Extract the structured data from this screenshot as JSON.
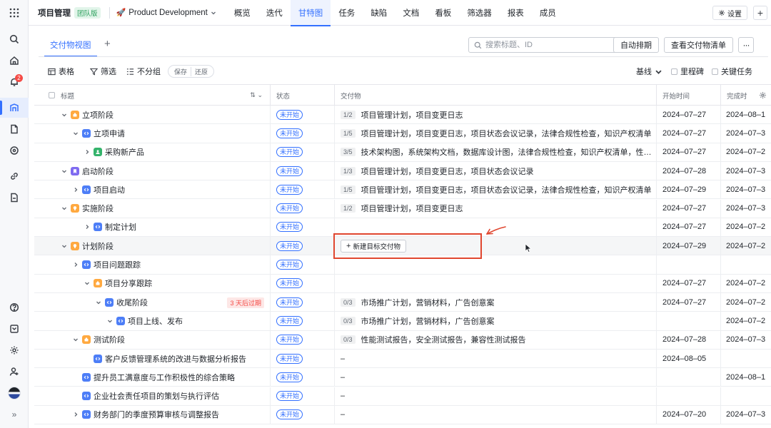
{
  "header": {
    "title": "项目管理",
    "edition": "团队版",
    "project_emoji": "🚀",
    "project_name": "Product Development",
    "tabs": [
      "概览",
      "迭代",
      "甘特图",
      "任务",
      "缺陷",
      "文档",
      "看板",
      "筛选器",
      "报表",
      "成员"
    ],
    "active_tab": "甘特图",
    "settings_label": "设置"
  },
  "view": {
    "tab_label": "交付物视图",
    "search_placeholder": "搜索标题、ID",
    "auto_schedule_label": "自动排期",
    "view_list_label": "查看交付物清单"
  },
  "toolbar": {
    "table_label": "表格",
    "filter_label": "筛选",
    "group_label": "不分组",
    "save_label": "保存",
    "restore_label": "还原",
    "baseline_label": "基线",
    "milestone_label": "里程碑",
    "critical_label": "关键任务"
  },
  "table": {
    "columns": {
      "title": "标题",
      "status": "状态",
      "deliverables": "交付物",
      "start": "开始时间",
      "end": "完成时"
    },
    "new_deliverable_label": "新建目标交付物",
    "rows": [
      {
        "title": "立项阶段",
        "status": "未开始",
        "progress": "1/2",
        "deliverables": "项目管理计划，项目变更日志",
        "start": "2024–07–27",
        "end": "2024–08–1"
      },
      {
        "title": "立项申请",
        "status": "未开始",
        "progress": "1/5",
        "deliverables": "项目管理计划，项目变更日志，项目状态会议记录，法律合规性检查，知识产权清单",
        "start": "2024–07–27",
        "end": "2024–07–3"
      },
      {
        "title": "采购新产品",
        "status": "未开始",
        "progress": "3/5",
        "deliverables": "技术架构图，系统架构文档，数据库设计图，法律合规性检查，知识产权清单，性能...",
        "start": "2024–07–27",
        "end": "2024–07–2"
      },
      {
        "title": "启动阶段",
        "status": "未开始",
        "progress": "1/3",
        "deliverables": "项目管理计划，项目变更日志，项目状态会议记录",
        "start": "2024–07–28",
        "end": "2024–07–3"
      },
      {
        "title": "项目启动",
        "status": "未开始",
        "progress": "1/5",
        "deliverables": "项目管理计划，项目变更日志，项目状态会议记录，法律合规性检查，知识产权清单",
        "start": "2024–07–29",
        "end": "2024–07–3"
      },
      {
        "title": "实施阶段",
        "status": "未开始",
        "progress": "1/2",
        "deliverables": "项目管理计划，项目变更日志",
        "start": "2024–07–27",
        "end": "2024–07–3"
      },
      {
        "title": "制定计划",
        "status": "未开始",
        "progress": "",
        "deliverables": "",
        "start": "2024–07–27",
        "end": "2024–07–2"
      },
      {
        "title": "计划阶段",
        "status": "未开始",
        "progress": "",
        "deliverables": "",
        "start": "2024–07–29",
        "end": "2024–07–2"
      },
      {
        "title": "项目问题跟踪",
        "status": "未开始",
        "progress": "",
        "deliverables": "",
        "start": "",
        "end": ""
      },
      {
        "title": "项目分享跟踪",
        "status": "未开始",
        "progress": "",
        "deliverables": "",
        "start": "2024–07–27",
        "end": "2024–07–2"
      },
      {
        "title": "收尾阶段",
        "status": "未开始",
        "overdue": "3 天后过期",
        "progress": "0/3",
        "deliverables": "市场推广计划，营销材料，广告创意案",
        "start": "2024–07–27",
        "end": "2024–07–2"
      },
      {
        "title": "项目上线、发布",
        "status": "未开始",
        "progress": "0/3",
        "deliverables": "市场推广计划，营销材料，广告创意案",
        "start": "",
        "end": "2024–07–2"
      },
      {
        "title": "测试阶段",
        "status": "未开始",
        "progress": "0/3",
        "deliverables": "性能测试报告，安全测试报告，兼容性测试报告",
        "start": "2024–07–28",
        "end": "2024–07–3"
      },
      {
        "title": "客户反馈管理系统的改进与数据分析报告",
        "status": "未开始",
        "progress": "",
        "deliverables": "–",
        "start": "2024–08–05",
        "end": ""
      },
      {
        "title": "提升员工满意度与工作积极性的综合策略",
        "status": "未开始",
        "progress": "",
        "deliverables": "–",
        "start": "",
        "end": "2024–08–1"
      },
      {
        "title": "企业社会责任项目的策划与执行评估",
        "status": "未开始",
        "progress": "",
        "deliverables": "–",
        "start": "",
        "end": ""
      },
      {
        "title": "财务部门的季度预算审核与调整报告",
        "status": "未开始",
        "progress": "",
        "deliverables": "–",
        "start": "2024–07–20",
        "end": "2024–07–3"
      }
    ]
  },
  "notifications_count": "2",
  "colors": {
    "accent": "#3370ff",
    "annotation": "#e0462f",
    "overdue": "#f54a45"
  }
}
